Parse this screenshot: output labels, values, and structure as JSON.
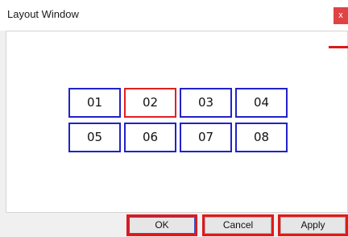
{
  "window": {
    "title": "Layout Window",
    "close_label": "x"
  },
  "layout": {
    "cells": [
      {
        "label": "01"
      },
      {
        "label": "02"
      },
      {
        "label": "03"
      },
      {
        "label": "04"
      },
      {
        "label": "05"
      },
      {
        "label": "06"
      },
      {
        "label": "07"
      },
      {
        "label": "08"
      }
    ],
    "selected_cell": "02"
  },
  "footer": {
    "ok_label": "OK",
    "cancel_label": "Cancel",
    "apply_label": "Apply"
  },
  "colors": {
    "cell_border": "#2222c8",
    "selected_border": "#e02020",
    "highlight_red": "#e31818",
    "close_bg": "#e04343"
  }
}
